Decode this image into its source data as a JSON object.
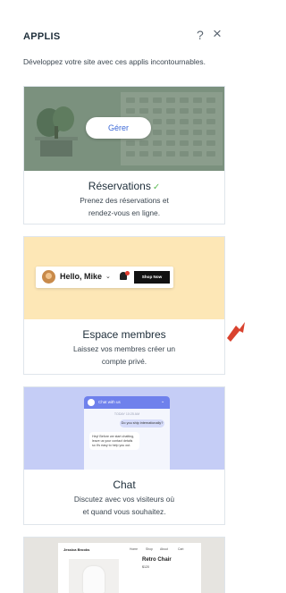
{
  "panel": {
    "title": "APPLIS",
    "help_icon": "?",
    "close_icon": "×",
    "subtitle": "Développez votre site avec ces applis incontournables."
  },
  "cards": [
    {
      "name": "Réservations",
      "check": "✓",
      "description_line1": "Prenez des réservations et",
      "description_line2": "rendez-vous en ligne.",
      "manage_button": "Gérer",
      "image_bg": "#8da590"
    },
    {
      "name": "Espace membres",
      "description_line1": "Laissez vos membres créer un",
      "description_line2": "compte privé.",
      "preview_greeting": "Hello, Mike",
      "preview_button": "Shop Now",
      "image_bg": "#fde7b6"
    },
    {
      "name": "Chat",
      "description_line1": "Discutez avec vos visiteurs où",
      "description_line2": "et quand vous souhaitez.",
      "preview_header": "Chat with us",
      "preview_time": "TODAY 10:25 AM",
      "preview_question": "Do you ship internationally?",
      "preview_reply": "Hey! Before we start chatting, leave us your contact details so it's easy to help you out.",
      "image_bg": "#c5cdf6"
    },
    {
      "preview_brand": "Jessica Brooks",
      "preview_nav": [
        "Home",
        "Shop",
        "About",
        "Cart"
      ],
      "preview_product": "Retro Chair",
      "preview_price": "$120",
      "image_bg": "#e6e4e0"
    }
  ],
  "colors": {
    "accent": "#3d6ad7",
    "check": "#60bc57",
    "arrow": "#d9422e",
    "text": "#20303c"
  }
}
